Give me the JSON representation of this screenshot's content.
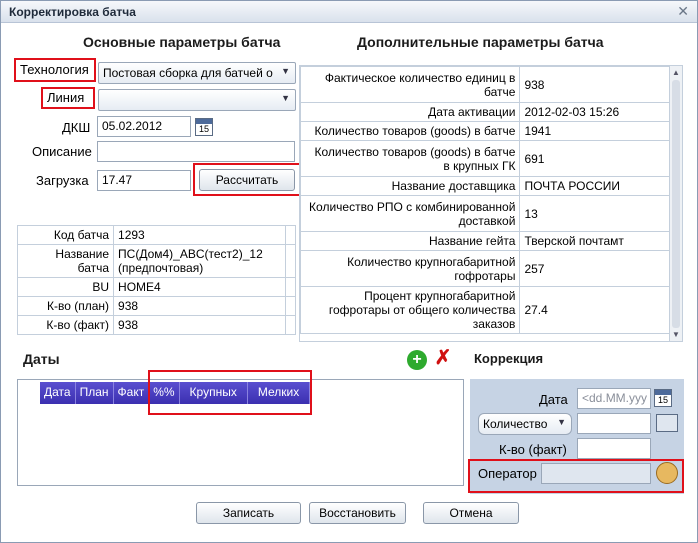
{
  "window": {
    "title": "Корректировка батча",
    "close": "✕"
  },
  "main": {
    "title": "Основные параметры батча",
    "technology": {
      "label": "Технология",
      "value": "Постовая сборка для батчей о"
    },
    "line": {
      "label": "Линия",
      "value": ""
    },
    "dkш": {
      "label": "ДКШ",
      "value": "05.02.2012",
      "cal": "15"
    },
    "description": {
      "label": "Описание",
      "value": ""
    },
    "load": {
      "label": "Загрузка",
      "value": "17.47"
    },
    "calc_button": "Рассчитать"
  },
  "batch_info": [
    {
      "key": "Код батча",
      "value": "1293"
    },
    {
      "key": "Название батча",
      "value": "ПС(Дом4)_ABC(тест2)_12 (предпочтовая)"
    },
    {
      "key": "BU",
      "value": "HOME4"
    },
    {
      "key": "К-во (план)",
      "value": "938"
    },
    {
      "key": "К-во (факт)",
      "value": "938"
    }
  ],
  "extra": {
    "title": "Дополнительные параметры батча",
    "rows": [
      {
        "key": "Фактическое количество единиц в батче",
        "value": "938"
      },
      {
        "key": "Дата активации",
        "value": "2012-02-03 15:26"
      },
      {
        "key": "Количество товаров (goods) в батче",
        "value": "1941"
      },
      {
        "key": "Количество товаров (goods) в батче в крупных ГК",
        "value": "691"
      },
      {
        "key": "Название доставщика",
        "value": "ПОЧТА РОССИИ"
      },
      {
        "key": "Количество РПО с комбинированной доставкой",
        "value": "13"
      },
      {
        "key": "Название гейта",
        "value": "Тверской почтамт"
      },
      {
        "key": "Количество крупногабаритной гофротары",
        "value": "257"
      },
      {
        "key": "Процент крупногабаритной гофротары от общего количества заказов",
        "value": "27.4"
      }
    ]
  },
  "dates": {
    "title": "Даты",
    "columns": [
      "Дата",
      "План",
      "Факт",
      "%%",
      "Крупных",
      "Мелких"
    ]
  },
  "correction": {
    "title": "Коррекция",
    "date": {
      "label": "Дата",
      "placeholder": "<dd.MM.yyy",
      "cal": "15"
    },
    "quantity_select": "Количество",
    "fact": {
      "label": "К-во (факт)",
      "value": ""
    },
    "operator": {
      "label": "Оператор",
      "value": ""
    }
  },
  "footer": {
    "save": "Записать",
    "restore": "Восстановить",
    "cancel": "Отмена"
  },
  "colors": {
    "accent": "#3b2fb0",
    "highlight": "#e0101a",
    "panel": "#c6d3e4"
  }
}
